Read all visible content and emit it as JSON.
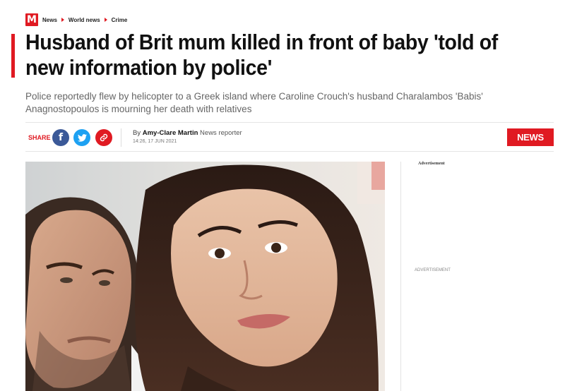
{
  "breadcrumb": {
    "logo": "M",
    "items": [
      "News",
      "World news",
      "Crime"
    ]
  },
  "article": {
    "headline": "Husband of Brit mum killed in front of baby 'told of new information by police'",
    "standfirst": "Police reportedly flew by helicopter to a Greek island where Caroline Crouch's husband Charalambos 'Babis' Anagnostopoulos is mourning her death with relatives",
    "byline_prefix": "By",
    "author": "Amy-Clare Martin",
    "author_role": "News reporter",
    "timestamp": "14:26, 17 JUN 2021",
    "section_badge": "NEWS"
  },
  "share": {
    "label": "SHARE",
    "buttons": [
      {
        "icon": "facebook-icon",
        "glyph": "f"
      },
      {
        "icon": "twitter-icon",
        "glyph": "🐦"
      },
      {
        "icon": "link-icon",
        "glyph": "🔗"
      }
    ]
  },
  "sidebar": {
    "ad_label_top": "Advertisement",
    "ad_label_mid": "ADVERTISEMENT"
  },
  "colors": {
    "brand_red": "#e01a22",
    "facebook": "#3b5998",
    "twitter": "#1da1f2",
    "standfirst_gray": "#666666"
  }
}
